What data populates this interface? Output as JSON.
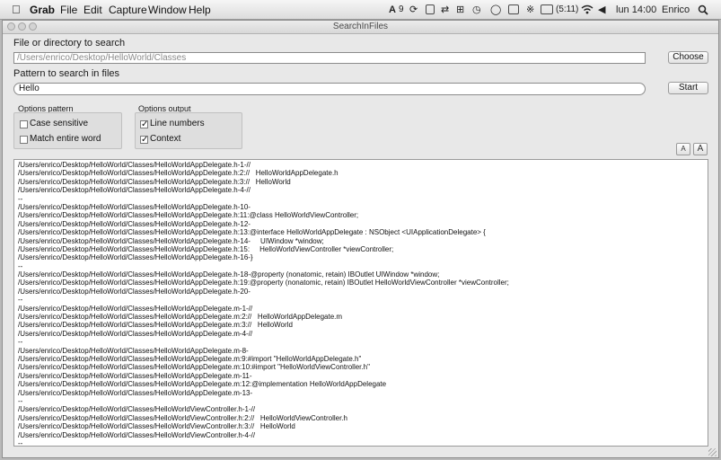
{
  "menubar": {
    "app_name": "Grab",
    "items": [
      "File",
      "Edit",
      "Capture",
      "Window",
      "Help"
    ],
    "adobe_badge": "9",
    "battery_time": "(5:11)",
    "clock": "lun 14:00",
    "user": "Enrico"
  },
  "window": {
    "title": "SearchInFiles",
    "dir_label": "File or directory to search",
    "dir_value": "/Users/enrico/Desktop/HelloWorld/Classes",
    "choose_label": "Choose",
    "pattern_label": "Pattern to search in files",
    "pattern_value": "Hello",
    "start_label": "Start",
    "options_pattern": {
      "title": "Options pattern",
      "case_sensitive": {
        "label": "Case sensitive",
        "checked": false
      },
      "match_entire_word": {
        "label": "Match entire word",
        "checked": false
      }
    },
    "options_output": {
      "title": "Options output",
      "line_numbers": {
        "label": "Line numbers",
        "checked": true
      },
      "context": {
        "label": "Context",
        "checked": true
      }
    },
    "font_smaller": "A",
    "font_larger": "A"
  },
  "results": [
    "/Users/enrico/Desktop/HelloWorld/Classes/HelloWorldAppDelegate.h-1-//",
    "/Users/enrico/Desktop/HelloWorld/Classes/HelloWorldAppDelegate.h:2://   HelloWorldAppDelegate.h",
    "/Users/enrico/Desktop/HelloWorld/Classes/HelloWorldAppDelegate.h:3://   HelloWorld",
    "/Users/enrico/Desktop/HelloWorld/Classes/HelloWorldAppDelegate.h-4-//",
    "--",
    "/Users/enrico/Desktop/HelloWorld/Classes/HelloWorldAppDelegate.h-10-",
    "/Users/enrico/Desktop/HelloWorld/Classes/HelloWorldAppDelegate.h:11:@class HelloWorldViewController;",
    "/Users/enrico/Desktop/HelloWorld/Classes/HelloWorldAppDelegate.h-12-",
    "/Users/enrico/Desktop/HelloWorld/Classes/HelloWorldAppDelegate.h:13:@interface HelloWorldAppDelegate : NSObject <UIApplicationDelegate> {",
    "/Users/enrico/Desktop/HelloWorld/Classes/HelloWorldAppDelegate.h-14-     UIWindow *window;",
    "/Users/enrico/Desktop/HelloWorld/Classes/HelloWorldAppDelegate.h:15:     HelloWorldViewController *viewController;",
    "/Users/enrico/Desktop/HelloWorld/Classes/HelloWorldAppDelegate.h-16-}",
    "--",
    "/Users/enrico/Desktop/HelloWorld/Classes/HelloWorldAppDelegate.h-18-@property (nonatomic, retain) IBOutlet UIWindow *window;",
    "/Users/enrico/Desktop/HelloWorld/Classes/HelloWorldAppDelegate.h:19:@property (nonatomic, retain) IBOutlet HelloWorldViewController *viewController;",
    "/Users/enrico/Desktop/HelloWorld/Classes/HelloWorldAppDelegate.h-20-",
    "--",
    "/Users/enrico/Desktop/HelloWorld/Classes/HelloWorldAppDelegate.m-1-//",
    "/Users/enrico/Desktop/HelloWorld/Classes/HelloWorldAppDelegate.m:2://   HelloWorldAppDelegate.m",
    "/Users/enrico/Desktop/HelloWorld/Classes/HelloWorldAppDelegate.m:3://   HelloWorld",
    "/Users/enrico/Desktop/HelloWorld/Classes/HelloWorldAppDelegate.m-4-//",
    "--",
    "/Users/enrico/Desktop/HelloWorld/Classes/HelloWorldAppDelegate.m-8-",
    "/Users/enrico/Desktop/HelloWorld/Classes/HelloWorldAppDelegate.m:9:#import \"HelloWorldAppDelegate.h\"",
    "/Users/enrico/Desktop/HelloWorld/Classes/HelloWorldAppDelegate.m:10:#import \"HelloWorldViewController.h\"",
    "/Users/enrico/Desktop/HelloWorld/Classes/HelloWorldAppDelegate.m-11-",
    "/Users/enrico/Desktop/HelloWorld/Classes/HelloWorldAppDelegate.m:12:@implementation HelloWorldAppDelegate",
    "/Users/enrico/Desktop/HelloWorld/Classes/HelloWorldAppDelegate.m-13-",
    "--",
    "/Users/enrico/Desktop/HelloWorld/Classes/HelloWorldViewController.h-1-//",
    "/Users/enrico/Desktop/HelloWorld/Classes/HelloWorldViewController.h:2://   HelloWorldViewController.h",
    "/Users/enrico/Desktop/HelloWorld/Classes/HelloWorldViewController.h:3://   HelloWorld",
    "/Users/enrico/Desktop/HelloWorld/Classes/HelloWorldViewController.h-4-//",
    "--"
  ]
}
